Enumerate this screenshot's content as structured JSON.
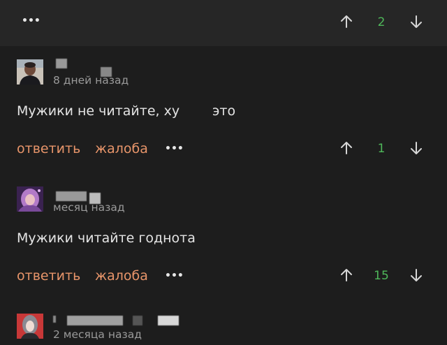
{
  "header": {
    "menu_icon": "more-dots-icon",
    "score": "2"
  },
  "comments": [
    {
      "time": "8 дней назад",
      "text_part1": "Мужики не читайте, ху",
      "text_part2": "это",
      "reply_label": "ответить",
      "report_label": "жалоба",
      "score": "1"
    },
    {
      "time": "месяц назад",
      "text": "Мужики читайте годнота",
      "reply_label": "ответить",
      "report_label": "жалоба",
      "score": "15"
    },
    {
      "time": "2 месяца назад"
    }
  ],
  "colors": {
    "background": "#1d1d1d",
    "topbar": "#262626",
    "accent_action": "#e8956a",
    "score_positive": "#4fb85a"
  }
}
